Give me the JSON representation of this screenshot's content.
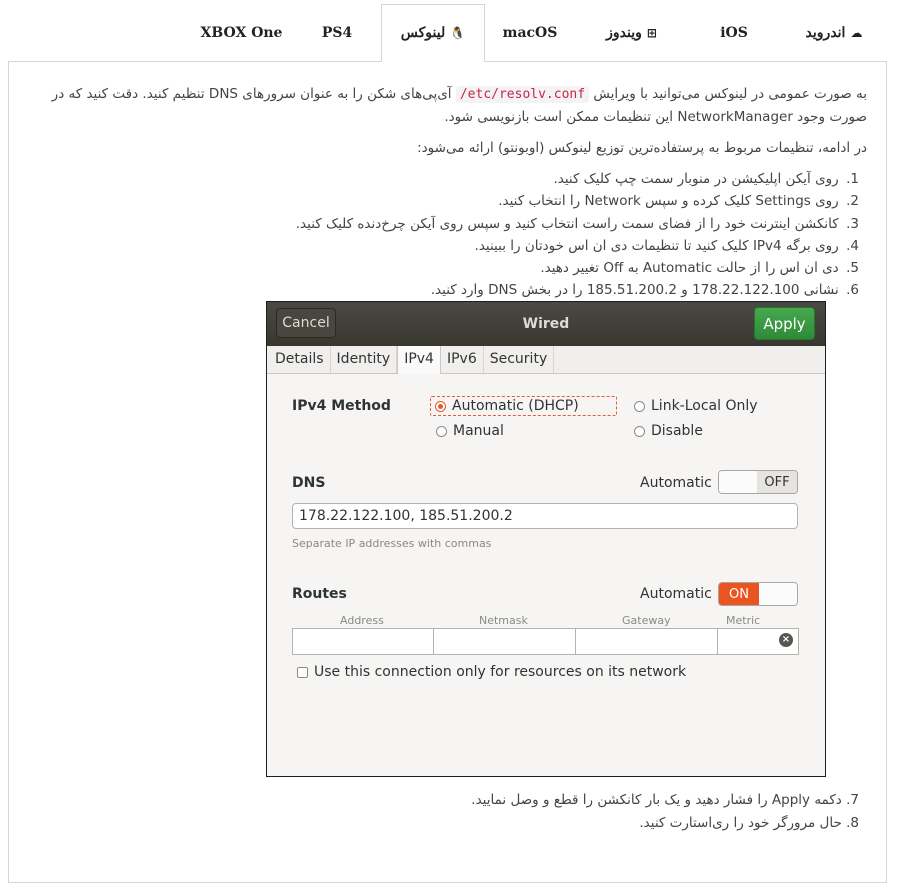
{
  "tabs": [
    {
      "label": "اندروید",
      "icon": "android-icon",
      "glyph": "☁",
      "active": false
    },
    {
      "label": "iOS",
      "icon": "apple-icon",
      "glyph": "",
      "active": false
    },
    {
      "label": "ویندوز",
      "icon": "windows-icon",
      "glyph": "⊞",
      "active": false
    },
    {
      "label": "macOS",
      "icon": "apple-icon",
      "glyph": "",
      "active": false
    },
    {
      "label": "لینوکس",
      "icon": "linux-icon",
      "glyph": "🐧",
      "active": true
    },
    {
      "label": "PS4",
      "icon": "",
      "glyph": "",
      "active": false
    },
    {
      "label": "XBOX One",
      "icon": "",
      "glyph": "",
      "active": false
    }
  ],
  "intro": {
    "before_code": "به صورت عمومی در لینوکس می‌توانید با ویرایش ",
    "code": "/etc/resolv.conf",
    "after_code": " آی‌پی‌های شکن را به عنوان سرورهای DNS تنظیم کنید. دقت کنید که در صورت وجود NetworkManager این تنظیمات ممکن است بازنویسی شود.",
    "distro_note": "در ادامه، تنظیمات مربوط به پرستفاده‌ترین توزیع لینوکس (اوبونتو) ارائه می‌شود:"
  },
  "steps": [
    {
      "num": "1.",
      "text": "روی آیکن اپلیکیشن در منوبار سمت چپ کلیک کنید."
    },
    {
      "num": "2.",
      "text": "روی Settings کلیک کرده و سپس Network را انتخاب کنید."
    },
    {
      "num": "3.",
      "text": "کانکشن اینترنت خود را از فضای سمت راست انتخاب کنید و سپس روی آیکن چرخ‌دنده کلیک کنید."
    },
    {
      "num": "4.",
      "text": "روی برگه IPv4  کلیک کنید تا تنظیمات دی ان اس خودتان را ببینید."
    },
    {
      "num": "5.",
      "text": "دی ان اس را از حالت Automatic به Off تغییر دهید."
    },
    {
      "num": "6.",
      "text": "نشانی 178.22.122.100 و 185.51.200.2 را در بخش DNS وارد کنید."
    }
  ],
  "steps_after": [
    {
      "num": "7.",
      "text": "دکمه Apply را فشار دهید و یک بار کانکشن را قطع و وصل نمایید."
    },
    {
      "num": "8.",
      "text": "حال مرورگر خود را ری‌استارت کنید."
    }
  ],
  "dialog": {
    "title": "Wired",
    "cancel_label": "Cancel",
    "apply_label": "Apply",
    "apply_color": "#3c9c44",
    "accent_color": "#e95420",
    "tabs": [
      "Details",
      "Identity",
      "IPv4",
      "IPv6",
      "Security"
    ],
    "active_tab": "IPv4",
    "ipv4_method_label": "IPv4 Method",
    "methods": {
      "automatic": "Automatic (DHCP)",
      "link_local": "Link-Local Only",
      "manual": "Manual",
      "disable": "Disable"
    },
    "selected_method": "Automatic (DHCP)",
    "dns_label": "DNS",
    "dns_automatic_label": "Automatic",
    "dns_toggle": "OFF",
    "dns_value": "178.22.122.100, 185.51.200.2",
    "dns_hint": "Separate IP addresses with commas",
    "routes_label": "Routes",
    "routes_automatic_label": "Automatic",
    "routes_toggle": "ON",
    "routes_columns": [
      "Address",
      "Netmask",
      "Gateway",
      "Metric"
    ],
    "only_resources_label": "Use this connection only for resources on its network"
  }
}
